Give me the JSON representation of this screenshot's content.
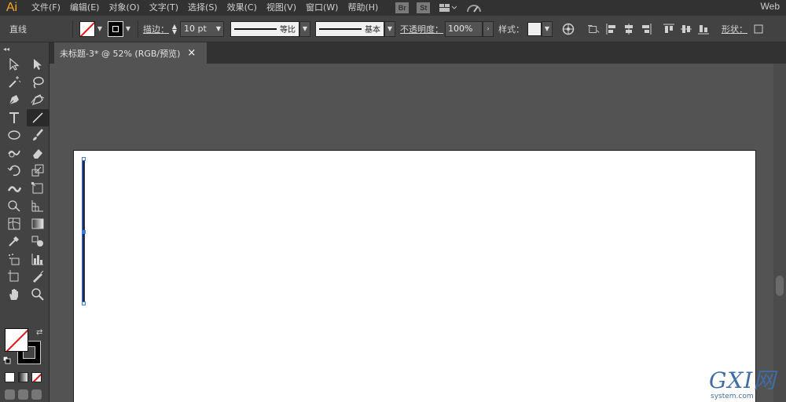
{
  "app": {
    "logo": "Ai",
    "workspace": "Web"
  },
  "menu": [
    "文件(F)",
    "编辑(E)",
    "对象(O)",
    "文字(T)",
    "选择(S)",
    "效果(C)",
    "视图(V)",
    "窗口(W)",
    "帮助(H)"
  ],
  "app_buttons": {
    "bridge": "Br",
    "stock": "St"
  },
  "control_bar": {
    "selection_type": "直线",
    "stroke_label": "描边：",
    "stroke_weight": "10 pt",
    "profile_label": "等比",
    "brush_label": "基本",
    "opacity_label": "不透明度：",
    "opacity_value": "100%",
    "style_label": "样式：",
    "shape_label": "形状："
  },
  "document_tab": {
    "title": "未标题-3* @ 52% (RGB/预览)",
    "close": "×"
  },
  "toolbar": {
    "collapse": "◂◂",
    "tools": [
      "selection-tool-icon",
      "direct-selection-tool-icon",
      "magic-wand-tool-icon",
      "lasso-tool-icon",
      "pen-tool-icon",
      "curvature-tool-icon",
      "type-tool-icon",
      "line-segment-tool-icon",
      "ellipse-tool-icon",
      "paintbrush-tool-icon",
      "shaper-tool-icon",
      "eraser-tool-icon",
      "rotate-tool-icon",
      "scale-tool-icon",
      "width-tool-icon",
      "free-transform-tool-icon",
      "shape-builder-tool-icon",
      "perspective-grid-tool-icon",
      "mesh-tool-icon",
      "gradient-tool-icon",
      "eyedropper-tool-icon",
      "blend-tool-icon",
      "symbol-sprayer-tool-icon",
      "column-graph-tool-icon",
      "artboard-tool-icon",
      "slice-tool-icon",
      "hand-tool-icon",
      "zoom-tool-icon"
    ],
    "active_tool": "line-segment-tool-icon"
  },
  "watermark": {
    "big": "GXI网",
    "small": "system.com"
  },
  "colors": {
    "accent_logo": "#f7a823",
    "selection": "#3d7bd9",
    "line": "#29294d",
    "none_red": "#e11111"
  }
}
